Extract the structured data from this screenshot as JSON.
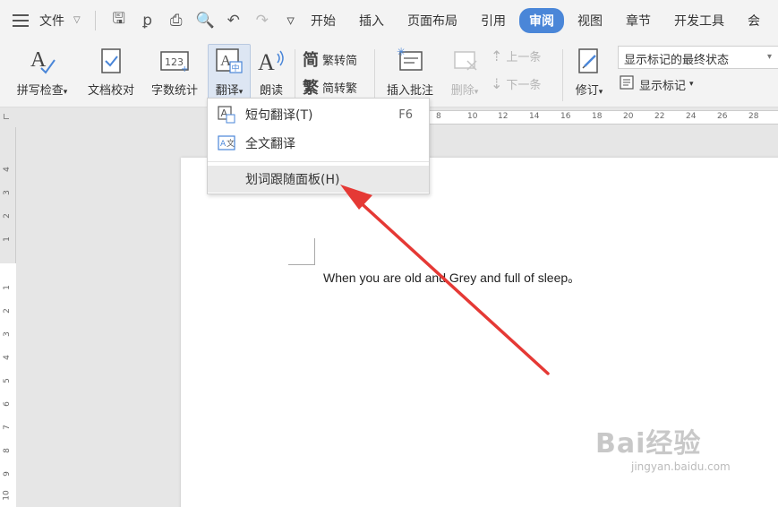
{
  "menubar": {
    "file_label": "文件",
    "tabs": [
      "开始",
      "插入",
      "页面布局",
      "引用",
      "审阅",
      "视图",
      "章节",
      "开发工具",
      "会"
    ],
    "active_tab": "审阅",
    "accent": "#4a86d8"
  },
  "ribbon": {
    "spell_check": "拼写检查",
    "doc_proof": "文档校对",
    "word_count": "字数统计",
    "translate": "翻译",
    "read_aloud": "朗读",
    "trad_to_simp": "繁转简",
    "simp_to_trad": "简转繁",
    "insert_comment": "插入批注",
    "delete": "删除",
    "prev_item": "上一条",
    "next_item": "下一条",
    "revise": "修订",
    "show_markup": "显示标记",
    "markup_state": "显示标记的最终状态"
  },
  "ruler": {
    "h_ticks": [
      "8",
      "10",
      "12",
      "14",
      "16",
      "18",
      "20",
      "22",
      "24",
      "26",
      "28"
    ],
    "v_ticks_top": [
      "4",
      "3",
      "2",
      "1"
    ],
    "v_ticks_bottom": [
      "1",
      "2",
      "3",
      "4",
      "5",
      "6",
      "7",
      "8",
      "9",
      "10"
    ]
  },
  "translate_menu": {
    "items": [
      {
        "label": "短句翻译(T)",
        "shortcut": "F6"
      },
      {
        "label": "全文翻译",
        "shortcut": ""
      },
      {
        "label": "划词跟随面板(H)",
        "shortcut": ""
      }
    ]
  },
  "document": {
    "text": "When you are old and Grey and full of sleep。"
  },
  "watermark": {
    "brand": "Bai经验",
    "url": "jingyan.baidu.com"
  },
  "colors": {
    "arrow": "#e53935"
  }
}
